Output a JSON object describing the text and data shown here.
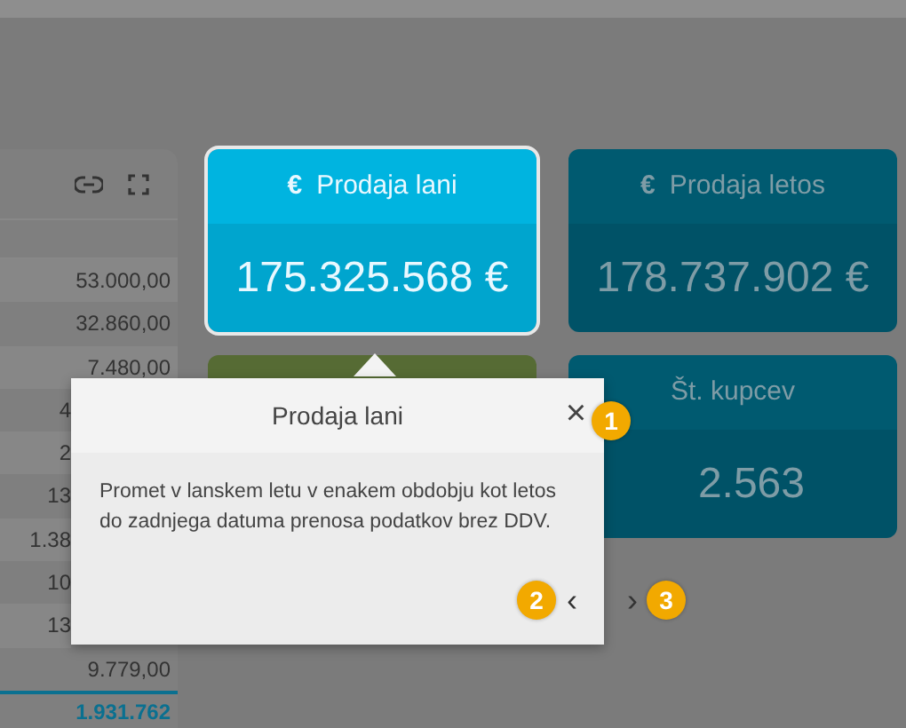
{
  "table": {
    "rows": [
      {
        "value": "53.000,00",
        "kind": "full"
      },
      {
        "value": "32.860,00",
        "kind": "full"
      },
      {
        "value": "7.480,00",
        "kind": "full"
      },
      {
        "value": "4",
        "kind": "partial"
      },
      {
        "value": "2",
        "kind": "partial"
      },
      {
        "value": "13",
        "kind": "partial"
      },
      {
        "value": "1.38",
        "kind": "partial"
      },
      {
        "value": "10",
        "kind": "partial"
      },
      {
        "value": "13",
        "kind": "partial"
      },
      {
        "value": "9.779,00",
        "kind": "full"
      }
    ],
    "total": "1.931.762"
  },
  "cards": [
    {
      "icon": "€",
      "title": "Prodaja lani",
      "value": "175.325.568 €",
      "highlighted": true,
      "color": "#00b4e0"
    },
    {
      "icon": "€",
      "title": "Prodaja letos",
      "value": "178.737.902 €",
      "highlighted": false,
      "color": "#005a70"
    },
    {
      "highlighted": false,
      "color": "#566b34"
    },
    {
      "title": "Št. kupcev",
      "value": "2.563",
      "highlighted": false,
      "color": "#005a70"
    }
  ],
  "tour": {
    "title": "Prodaja lani",
    "close": "×",
    "text": "Promet v lanskem letu v enakem obdobju kot letos do zadnjega datuma prenosa podatkov brez DDV.",
    "prev": "‹",
    "next": "›",
    "steps": [
      "1",
      "2",
      "3"
    ]
  }
}
